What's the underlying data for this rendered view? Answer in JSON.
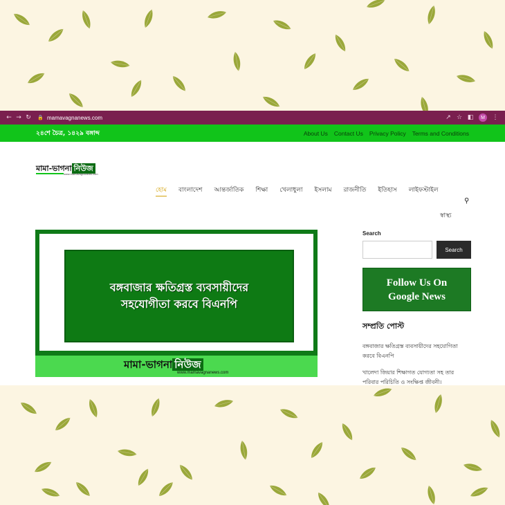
{
  "browser": {
    "url": "mamavagnanews.com",
    "profile_initial": "M",
    "accent": "#7a1f4f"
  },
  "topbar": {
    "date": "২৪শে চৈত্র, ১৪২৯ বঙ্গাব্দ",
    "links": [
      "About Us",
      "Contact Us",
      "Privacy Policy",
      "Terms and Conditions"
    ],
    "color": "#11c41a"
  },
  "logo": {
    "text_a": "মামা-ভাগনা",
    "text_b": "নিউজ",
    "site": "www.mamavagnanews.com"
  },
  "nav": {
    "items": [
      "হোম",
      "বাংলাদেশ",
      "আন্তর্জাতিক",
      "শিক্ষা",
      "খেলাধুলা",
      "ইসলাম",
      "রাজনীতি",
      "ইতিহাস",
      "লাইফস্টাইল"
    ],
    "row2": "স্বাস্থ্য"
  },
  "hero": {
    "line1": "বঙ্গবাজার ক্ষতিগ্রস্ত ব্যবসায়ীদের",
    "line2": "সহযোগীতা করবে বিএনপি",
    "brand_a": "মামা-ভাগনা",
    "brand_b": "নিউজ",
    "url": "www.mamavagnanews.com"
  },
  "sidebar": {
    "search_label": "Search",
    "search_placeholder": "",
    "search_button": "Search",
    "follow_line1": "Follow Us On",
    "follow_line2": "Google News",
    "recent_title": "সম্প্রতি পোস্ট",
    "posts": [
      "বঙ্গবাজার ক্ষতিগ্রস্ত ব্যবসায়ীদের সহযোগিতা করবে বিএনপি",
      "খালেদা জিয়ার শিক্ষাগত যোগ্যতা সহ তার পরিবার পরিচিতি ও সংক্ষিপ্ত জীবনী।"
    ]
  }
}
